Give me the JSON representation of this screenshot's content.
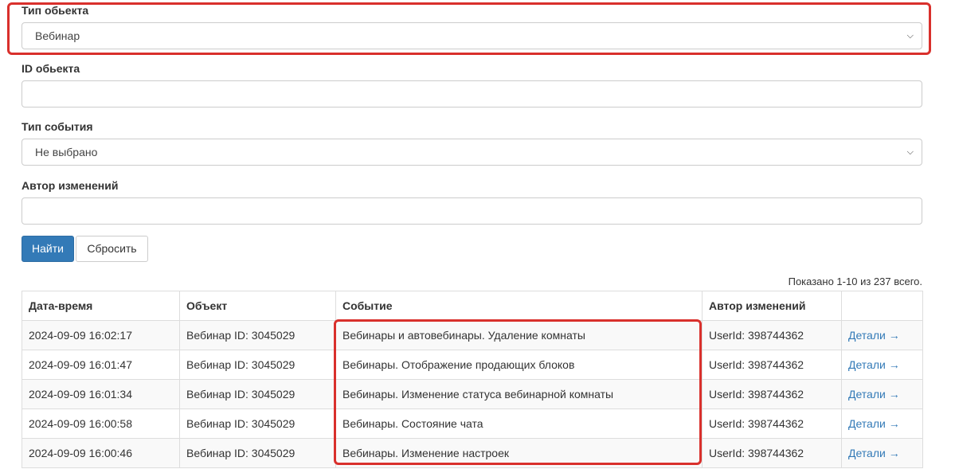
{
  "filters": {
    "object_type": {
      "label": "Тип обьекта",
      "value": "Вебинар"
    },
    "object_id": {
      "label": "ID обьекта",
      "value": ""
    },
    "event_type": {
      "label": "Тип события",
      "value": "Не выбрано"
    },
    "author": {
      "label": "Автор изменений",
      "value": ""
    }
  },
  "buttons": {
    "search": "Найти",
    "reset": "Сбросить"
  },
  "summary": "Показано 1-10 из 237 всего.",
  "table": {
    "headers": [
      "Дата-время",
      "Объект",
      "Событие",
      "Автор изменений",
      ""
    ],
    "rows": [
      {
        "datetime": "2024-09-09 16:02:17",
        "object": "Вебинар ID: 3045029",
        "event": "Вебинары и автовебинары. Удаление комнаты",
        "author": "UserId: 398744362",
        "details": "Детали →"
      },
      {
        "datetime": "2024-09-09 16:01:47",
        "object": "Вебинар ID: 3045029",
        "event": "Вебинары. Отображение продающих блоков",
        "author": "UserId: 398744362",
        "details": "Детали →"
      },
      {
        "datetime": "2024-09-09 16:01:34",
        "object": "Вебинар ID: 3045029",
        "event": "Вебинары. Изменение статуса вебинарной комнаты",
        "author": "UserId: 398744362",
        "details": "Детали →"
      },
      {
        "datetime": "2024-09-09 16:00:58",
        "object": "Вебинар ID: 3045029",
        "event": "Вебинары. Состояние чата",
        "author": "UserId: 398744362",
        "details": "Детали →"
      },
      {
        "datetime": "2024-09-09 16:00:46",
        "object": "Вебинар ID: 3045029",
        "event": "Вебинары. Изменение настроек",
        "author": "UserId: 398744362",
        "details": "Детали →"
      }
    ]
  },
  "icons": {
    "select_arrow": "chevron-down-icon"
  },
  "colors": {
    "highlight": "#d9302c",
    "primary": "#337ab7",
    "link": "#337ab7"
  }
}
